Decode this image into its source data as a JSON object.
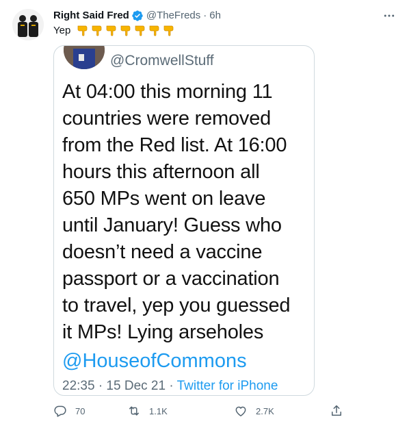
{
  "tweet": {
    "display_name": "Right Said Fred",
    "handle": "@TheFreds",
    "separator": "·",
    "time": "6h",
    "text": "Yep",
    "emoji_count": 7,
    "verified": true
  },
  "quoted_media": {
    "handle": "@CromwellStuff",
    "body_lines": [
      "At 04:00 this morning 11",
      "countries were removed",
      "from the Red list. At 16:00",
      "hours this afternoon all",
      "650 MPs went on leave",
      "until January! Guess who",
      "doesn’t need a vaccine",
      "passport or a vaccination",
      "to travel, yep you guessed",
      "it MPs! Lying arseholes"
    ],
    "mention": "@HouseofCommons",
    "timestamp": "22:35 · 15 Dec 21 · ",
    "source": "Twitter for iPhone"
  },
  "actions": {
    "reply_count": "70",
    "retweet_count": "1.1K",
    "like_count": "2.7K"
  },
  "colors": {
    "accent": "#1d9bf0",
    "secondary_text": "#536471"
  }
}
